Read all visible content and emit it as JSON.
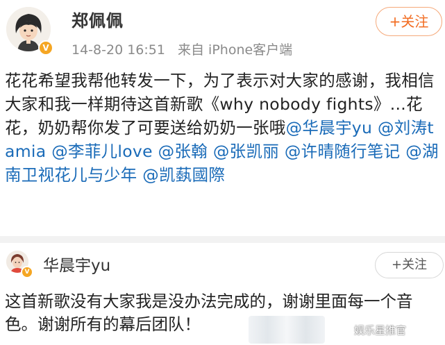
{
  "post": {
    "author_name": "郑佩佩",
    "timestamp": "14-8-20 16:51",
    "source": "来自 iPhone客户端",
    "follow_label": "+关注",
    "text_intro": "花花希望我帮他转发一下，为了表示对大家的感谢，我相信大家和我一样期待这首新歌《why nobody fights》...花花，奶奶帮你发了可要送给奶奶一张哦",
    "mentions": [
      "@华晨宇yu",
      "@刘涛tamia",
      "@李菲儿love",
      "@张翰",
      "@张凯丽",
      "@许晴随行笔记",
      "@湖南卫视花儿与少年",
      "@凯蓺國際"
    ]
  },
  "reply": {
    "author_name": "华晨宇yu",
    "follow_label": "+关注",
    "text": "这首新歌没有大家我是没办法完成的，谢谢里面每一个音色。谢谢所有的幕后团队！"
  },
  "watermark": "娱乐星推官",
  "colors": {
    "mention": "#1a6bb8",
    "follow_accent": "#f26c21",
    "verified": "#f5a623",
    "meta_text": "#8a8a8a"
  }
}
